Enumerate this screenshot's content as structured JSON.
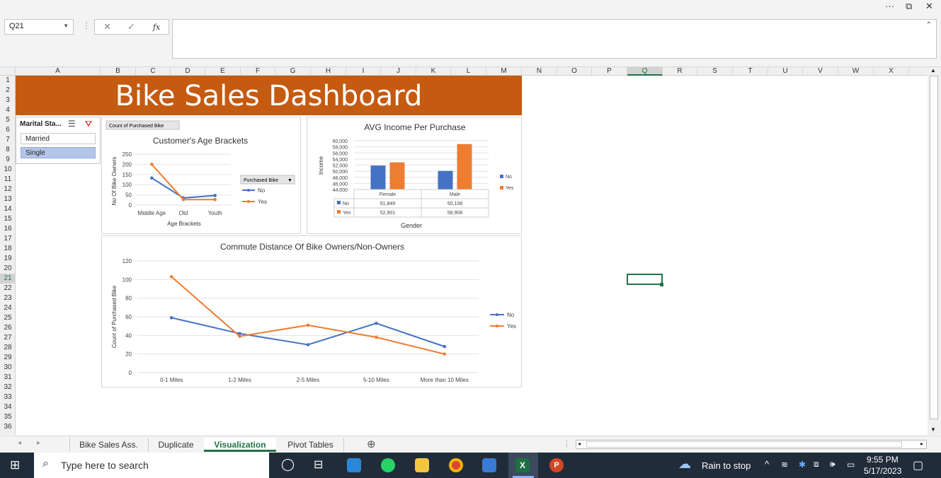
{
  "namebox": "Q21",
  "fx": "fx",
  "columns": [
    "A",
    "B",
    "C",
    "D",
    "E",
    "F",
    "G",
    "H",
    "I",
    "J",
    "K",
    "L",
    "M",
    "N",
    "O",
    "P",
    "Q",
    "R",
    "S",
    "T",
    "U",
    "V",
    "W",
    "X"
  ],
  "rows": [
    "1",
    "2",
    "3",
    "4",
    "5",
    "6",
    "7",
    "8",
    "9",
    "10",
    "11",
    "12",
    "13",
    "14",
    "15",
    "16",
    "17",
    "18",
    "19",
    "20",
    "21",
    "22",
    "23",
    "24",
    "25",
    "26",
    "27",
    "28",
    "29",
    "30",
    "31",
    "32",
    "33",
    "34",
    "35",
    "36"
  ],
  "banner_title": "Bike Sales Dashboard",
  "slicer": {
    "title": "Marital Sta...",
    "items": [
      "Married",
      "Single"
    ],
    "selected": "Single"
  },
  "tabs": [
    {
      "label": "Bike Sales Ass.",
      "active": false
    },
    {
      "label": "Duplicate",
      "active": false
    },
    {
      "label": "Visualization",
      "active": true
    },
    {
      "label": "Pivot Tables",
      "active": false
    }
  ],
  "taskbar": {
    "search_placeholder": "Type here to search",
    "weather": "Rain to stop",
    "time": "9:55 PM",
    "date": "5/17/2023"
  },
  "chart_data": [
    {
      "type": "line",
      "title": "Customer's Age Brackets",
      "pivot_button": "Count of Purchased Bike",
      "legend_filter": "Purchased Bike",
      "xlabel": "Age Brackets",
      "ylabel": "No Of Bike Owners",
      "categories": [
        "Middle Age",
        "Old",
        "Youth"
      ],
      "yticks": [
        "0",
        "50",
        "100",
        "150",
        "200",
        "250"
      ],
      "ylim": [
        0,
        250
      ],
      "series": [
        {
          "name": "No",
          "color": "#4472c4",
          "values": [
            133,
            35,
            47
          ]
        },
        {
          "name": "Yes",
          "color": "#ed7d31",
          "values": [
            200,
            27,
            27
          ]
        }
      ]
    },
    {
      "type": "bar",
      "title": "AVG Income Per Purchase",
      "xlabel": "Gender",
      "ylabel": "Income",
      "categories": [
        "Female",
        "Male"
      ],
      "yticks": [
        "44,000",
        "46,000",
        "48,000",
        "50,000",
        "52,000",
        "54,000",
        "56,000",
        "58,000",
        "60,000"
      ],
      "ylim": [
        44000,
        60000
      ],
      "series": [
        {
          "name": "No",
          "color": "#4472c4",
          "values": [
            51849,
            50108
          ],
          "labels": [
            "51,849",
            "50,108"
          ]
        },
        {
          "name": "Yes",
          "color": "#ed7d31",
          "values": [
            52901,
            58908
          ],
          "labels": [
            "52,901",
            "58,908"
          ]
        }
      ]
    },
    {
      "type": "line",
      "title": "Commute Distance Of Bike Owners/Non-Owners",
      "ylabel": "Count of Purchased Bike",
      "categories": [
        "0-1 Miles",
        "1-2 Miles",
        "2-5 Miles",
        "5-10 Miles",
        "More than 10 Miles"
      ],
      "yticks": [
        "0",
        "20",
        "40",
        "60",
        "80",
        "100",
        "120"
      ],
      "ylim": [
        0,
        120
      ],
      "series": [
        {
          "name": "No",
          "color": "#4472c4",
          "values": [
            59,
            42,
            30,
            53,
            28
          ]
        },
        {
          "name": "Yes",
          "color": "#ed7d31",
          "values": [
            103,
            39,
            51,
            38,
            20
          ]
        }
      ]
    }
  ]
}
